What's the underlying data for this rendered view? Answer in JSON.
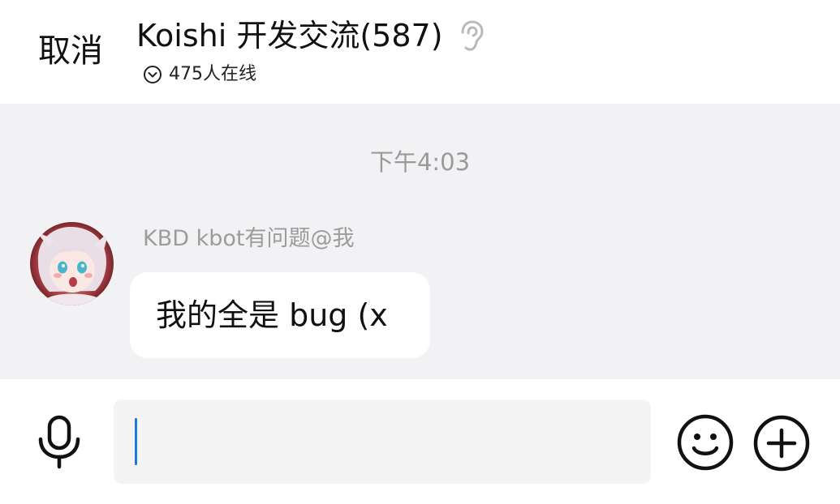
{
  "header": {
    "cancel_label": "取消",
    "title": "Koishi 开发交流(587)",
    "title_icon": "ear-icon",
    "online_icon": "chevron-down-circle-icon",
    "online_text": "475人在线"
  },
  "chat": {
    "timestamp": "下午4:03",
    "messages": [
      {
        "sender": "KBD kbot有问题@我",
        "avatar": "anime-avatar",
        "text": "我的全是 bug (x"
      }
    ]
  },
  "input_bar": {
    "value": "",
    "placeholder": "",
    "voice_icon": "microphone-icon",
    "emoji_icon": "smiley-icon",
    "more_icon": "plus-circle-icon"
  },
  "colors": {
    "chat_background": "#f2f1f4",
    "bubble_background": "#ffffff",
    "input_background": "#f4f4f5",
    "caret": "#1f7ae0",
    "muted_text": "#9a9a9a"
  }
}
